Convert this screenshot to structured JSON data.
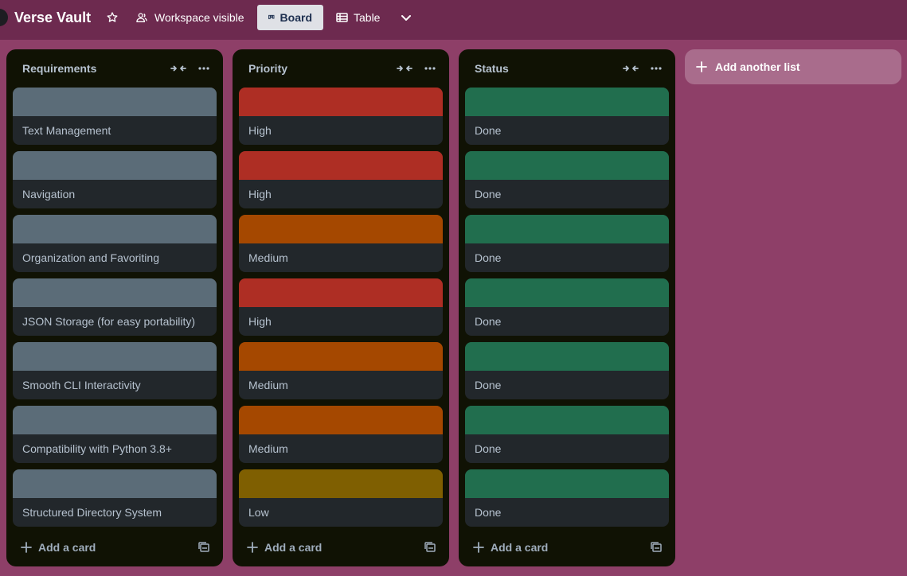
{
  "header": {
    "board_title": "Verse Vault",
    "visibility_label": "Workspace visible",
    "views": [
      {
        "label": "Board",
        "active": true,
        "icon": "board-icon"
      },
      {
        "label": "Table",
        "active": false,
        "icon": "table-icon"
      }
    ]
  },
  "colors": {
    "background": "#8e3f68",
    "topbar": "#6d2a4f",
    "list_bg": "#101204",
    "card_bg": "#22272b",
    "gray_label": "#5b6c78",
    "red_label": "#ae2e24",
    "orange_label": "#a54800",
    "yellow_label": "#7f5f01",
    "green_label": "#216e4e"
  },
  "lists": [
    {
      "title": "Requirements",
      "cards": [
        {
          "text": "Text Management",
          "label_color": "gray"
        },
        {
          "text": "Navigation",
          "label_color": "gray"
        },
        {
          "text": "Organization and Favoriting",
          "label_color": "gray"
        },
        {
          "text": "JSON Storage (for easy portability)",
          "label_color": "gray"
        },
        {
          "text": "Smooth CLI Interactivity",
          "label_color": "gray"
        },
        {
          "text": "Compatibility with Python 3.8+",
          "label_color": "gray"
        },
        {
          "text": "Structured Directory System",
          "label_color": "gray"
        }
      ],
      "add_card_label": "Add a card"
    },
    {
      "title": "Priority",
      "cards": [
        {
          "text": "High",
          "label_color": "red"
        },
        {
          "text": "High",
          "label_color": "red"
        },
        {
          "text": "Medium",
          "label_color": "orange"
        },
        {
          "text": "High",
          "label_color": "red"
        },
        {
          "text": "Medium",
          "label_color": "orange"
        },
        {
          "text": "Medium",
          "label_color": "orange"
        },
        {
          "text": "Low",
          "label_color": "yellow"
        }
      ],
      "add_card_label": "Add a card"
    },
    {
      "title": "Status",
      "cards": [
        {
          "text": "Done",
          "label_color": "green"
        },
        {
          "text": "Done",
          "label_color": "green"
        },
        {
          "text": "Done",
          "label_color": "green"
        },
        {
          "text": "Done",
          "label_color": "green"
        },
        {
          "text": "Done",
          "label_color": "green"
        },
        {
          "text": "Done",
          "label_color": "green"
        },
        {
          "text": "Done",
          "label_color": "green"
        }
      ],
      "add_card_label": "Add a card"
    }
  ],
  "add_list_label": "Add another list"
}
